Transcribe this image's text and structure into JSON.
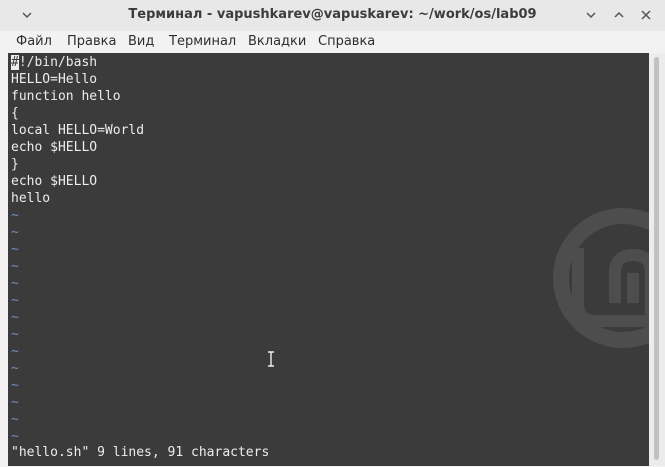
{
  "window": {
    "title": "Терминал - vapushkarev@vapuskarev: ~/work/os/lab09"
  },
  "menu": [
    "Файл",
    "Правка",
    "Вид",
    "Терминал",
    "Вкладки",
    "Справка"
  ],
  "editor": {
    "cursor_char": "#",
    "lines": [
      "!/bin/bash",
      "HELLO=Hello",
      "function hello",
      "{",
      "local HELLO=World",
      "echo $HELLO",
      "}",
      "echo $HELLO",
      "hello"
    ],
    "tilde": "~",
    "status": "\"hello.sh\" 9 lines, 91 characters"
  },
  "icons": [
    "collapse-chevron-icon",
    "minimize-icon",
    "maximize-icon",
    "close-icon",
    "mint-logo-icon",
    "text-cursor-icon"
  ]
}
